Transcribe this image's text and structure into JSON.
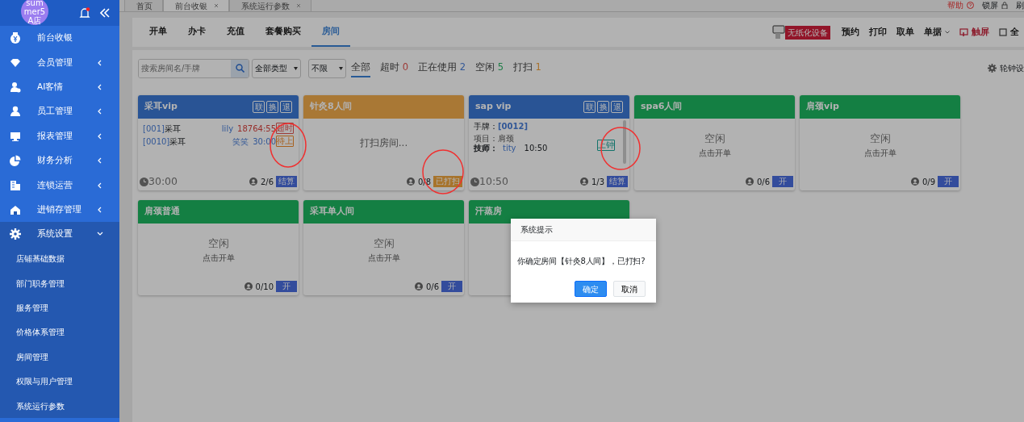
{
  "sidebar": {
    "store_name": "summer5A店",
    "menu": [
      {
        "label": "前台收银",
        "has_submenu": false,
        "expanded": false
      },
      {
        "label": "会员管理",
        "has_submenu": true,
        "expanded": false
      },
      {
        "label": "AI客情",
        "has_submenu": true,
        "expanded": false
      },
      {
        "label": "员工管理",
        "has_submenu": true,
        "expanded": false
      },
      {
        "label": "报表管理",
        "has_submenu": true,
        "expanded": false
      },
      {
        "label": "财务分析",
        "has_submenu": true,
        "expanded": false
      },
      {
        "label": "连锁运营",
        "has_submenu": true,
        "expanded": false
      },
      {
        "label": "进销存管理",
        "has_submenu": true,
        "expanded": false
      },
      {
        "label": "系统设置",
        "has_submenu": true,
        "expanded": true,
        "children": [
          "店铺基础数据",
          "部门职务管理",
          "服务管理",
          "价格体系管理",
          "房间管理",
          "权限与用户管理",
          "系统运行参数"
        ]
      }
    ]
  },
  "page_tabs": [
    {
      "label": "首页",
      "selected": false,
      "closable": false
    },
    {
      "label": "前台收银",
      "selected": true,
      "closable": true
    },
    {
      "label": "系统运行参数",
      "selected": false,
      "closable": true
    }
  ],
  "top_links": [
    {
      "label": "帮助",
      "kind": "help"
    },
    {
      "label": "锁屏",
      "kind": "lock"
    },
    {
      "label": "刷",
      "kind": "plain"
    }
  ],
  "nav_tabs": [
    {
      "label": "开单",
      "selected": false
    },
    {
      "label": "办卡",
      "selected": false
    },
    {
      "label": "充值",
      "selected": false
    },
    {
      "label": "套餐购买",
      "selected": false
    },
    {
      "label": "房间",
      "selected": true
    }
  ],
  "device_banner": "无纸化设备",
  "actions": [
    {
      "label": "预约",
      "kind": "plain"
    },
    {
      "label": "打印",
      "kind": "plain"
    },
    {
      "label": "取单",
      "kind": "plain"
    },
    {
      "label": "单据",
      "kind": "dropdown"
    },
    {
      "label": "触屏",
      "kind": "touch"
    },
    {
      "label": "全",
      "kind": "fullscreen"
    }
  ],
  "filters": {
    "search_placeholder": "搜索房间名/手牌",
    "type_select": "全部类型",
    "limit_select": "不限",
    "status_tabs": [
      {
        "label": "全部",
        "selected": true
      },
      {
        "label": "超时",
        "count": "0",
        "kind": "overtime",
        "selected": false
      },
      {
        "label": "正在使用",
        "count": "2",
        "kind": "in_use",
        "selected": false
      },
      {
        "label": "空闲",
        "count": "5",
        "kind": "idle",
        "selected": false
      },
      {
        "label": "打扫",
        "count": "1",
        "kind": "cleaning",
        "selected": false
      }
    ],
    "settings_label": "轮钟设"
  },
  "rooms": [
    {
      "name": "采耳vip",
      "kind": "in_use",
      "header_buttons": [
        "联",
        "换",
        "退"
      ],
      "orders": [
        {
          "code": "[001]",
          "service": "采耳",
          "tech": "lily",
          "time": "18764:55",
          "kind": "overtime",
          "tag": "超时"
        },
        {
          "code": "[0010]",
          "service": "采耳",
          "tech": "笑笑",
          "time": "30:00",
          "kind": "waiting",
          "tag": "待上"
        }
      ],
      "timer": "30:00",
      "occupancy": "2/6",
      "action": "结算"
    },
    {
      "name": "针灸8人间",
      "kind": "cleaning",
      "message": "打扫房间...",
      "occupancy": "0/8",
      "action": "已打扫"
    },
    {
      "name": "sap vip",
      "kind": "in_use_detail",
      "header_buttons": [
        "联",
        "换",
        "退"
      ],
      "hand_tag_label": "手牌：",
      "hand_tag": "[0012]",
      "project": "项目：肩颈",
      "tech_label": "技师：",
      "tech": "tity",
      "tech_time": "10:50",
      "tag": "上钟",
      "timer": "10:50",
      "occupancy": "1/3",
      "action": "结算"
    },
    {
      "name": "spa6人间",
      "kind": "idle",
      "status": "空闲",
      "hint": "点击开单",
      "occupancy": "0/6",
      "action": "开"
    },
    {
      "name": "肩颈vip",
      "kind": "idle",
      "status": "空闲",
      "hint": "点击开单",
      "occupancy": "0/9",
      "action": "开"
    },
    {
      "name": "肩颈普通",
      "kind": "idle",
      "status": "空闲",
      "hint": "点击开单",
      "occupancy": "0/10",
      "action": "开"
    },
    {
      "name": "采耳单人间",
      "kind": "idle",
      "status": "空闲",
      "hint": "点击开单",
      "occupancy": "0/6",
      "action": "开"
    },
    {
      "name": "汗蒸房",
      "kind": "idle_covered"
    }
  ],
  "dialog": {
    "title": "系统提示",
    "message": "你确定房间【针灸8人间】，已打扫?",
    "buttons": [
      {
        "label": "确定",
        "primary": true
      },
      {
        "label": "取消",
        "primary": false
      }
    ]
  }
}
